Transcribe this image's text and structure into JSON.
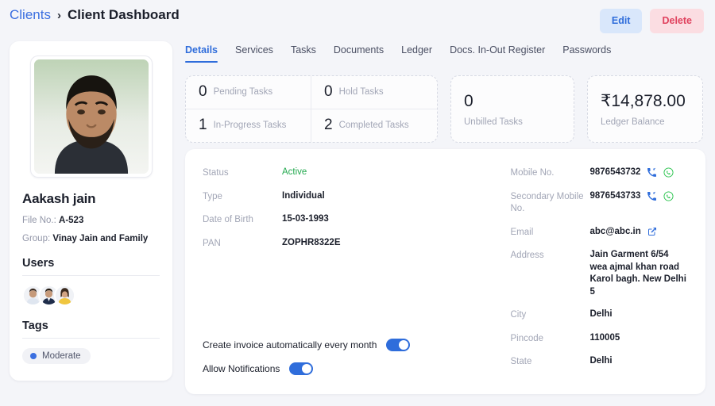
{
  "breadcrumb": {
    "parent": "Clients",
    "separator": "›",
    "current": "Client Dashboard"
  },
  "header": {
    "edit_label": "Edit",
    "delete_label": "Delete"
  },
  "sidebar": {
    "client_name": "Aakash jain",
    "file_no_label": "File No.:",
    "file_no_value": "A-523",
    "group_label": "Group:",
    "group_value": "Vinay Jain and Family",
    "users_title": "Users",
    "tags_title": "Tags",
    "tags": [
      {
        "label": "Moderate",
        "dot_color": "#3b6fe0"
      }
    ]
  },
  "tabs": [
    {
      "label": "Details",
      "active": true
    },
    {
      "label": "Services",
      "active": false
    },
    {
      "label": "Tasks",
      "active": false
    },
    {
      "label": "Documents",
      "active": false
    },
    {
      "label": "Ledger",
      "active": false
    },
    {
      "label": "Docs. In-Out Register",
      "active": false
    },
    {
      "label": "Passwords",
      "active": false
    }
  ],
  "stats": {
    "quad": [
      {
        "value": "0",
        "label": "Pending Tasks"
      },
      {
        "value": "0",
        "label": "Hold Tasks"
      },
      {
        "value": "1",
        "label": "In-Progress Tasks"
      },
      {
        "value": "2",
        "label": "Completed Tasks"
      }
    ],
    "unbilled": {
      "value": "0",
      "label": "Unbilled Tasks"
    },
    "ledger": {
      "value": "₹14,878.00",
      "label": "Ledger Balance"
    }
  },
  "details": {
    "left": [
      {
        "label": "Status",
        "value": "Active",
        "style": "green"
      },
      {
        "label": "Type",
        "value": "Individual",
        "style": "plain"
      },
      {
        "label": "Date of Birth",
        "value": "15-03-1993",
        "style": "plain"
      },
      {
        "label": "PAN",
        "value": "ZOPHR8322E",
        "style": "plain"
      }
    ],
    "right": [
      {
        "label": "Mobile No.",
        "value": "9876543732"
      },
      {
        "label": "Secondary Mobile No.",
        "value": "9876543733"
      },
      {
        "label": "Email",
        "value": "abc@abc.in"
      },
      {
        "label": "Address",
        "value": "Jain Garment 6/54 wea ajmal khan road Karol bagh. New Delhi 5"
      },
      {
        "label": "City",
        "value": "Delhi"
      },
      {
        "label": "Pincode",
        "value": "110005"
      },
      {
        "label": "State",
        "value": "Delhi"
      }
    ]
  },
  "toggles": [
    {
      "label": "Create invoice automatically every month",
      "on": true
    },
    {
      "label": "Allow Notifications",
      "on": true
    }
  ],
  "colors": {
    "accent": "#2f6ddb",
    "link": "#3b6fe0",
    "danger": "#e0425e",
    "success": "#23a94f",
    "whatsapp": "#25c24a",
    "page_bg": "#f4f5f9"
  }
}
